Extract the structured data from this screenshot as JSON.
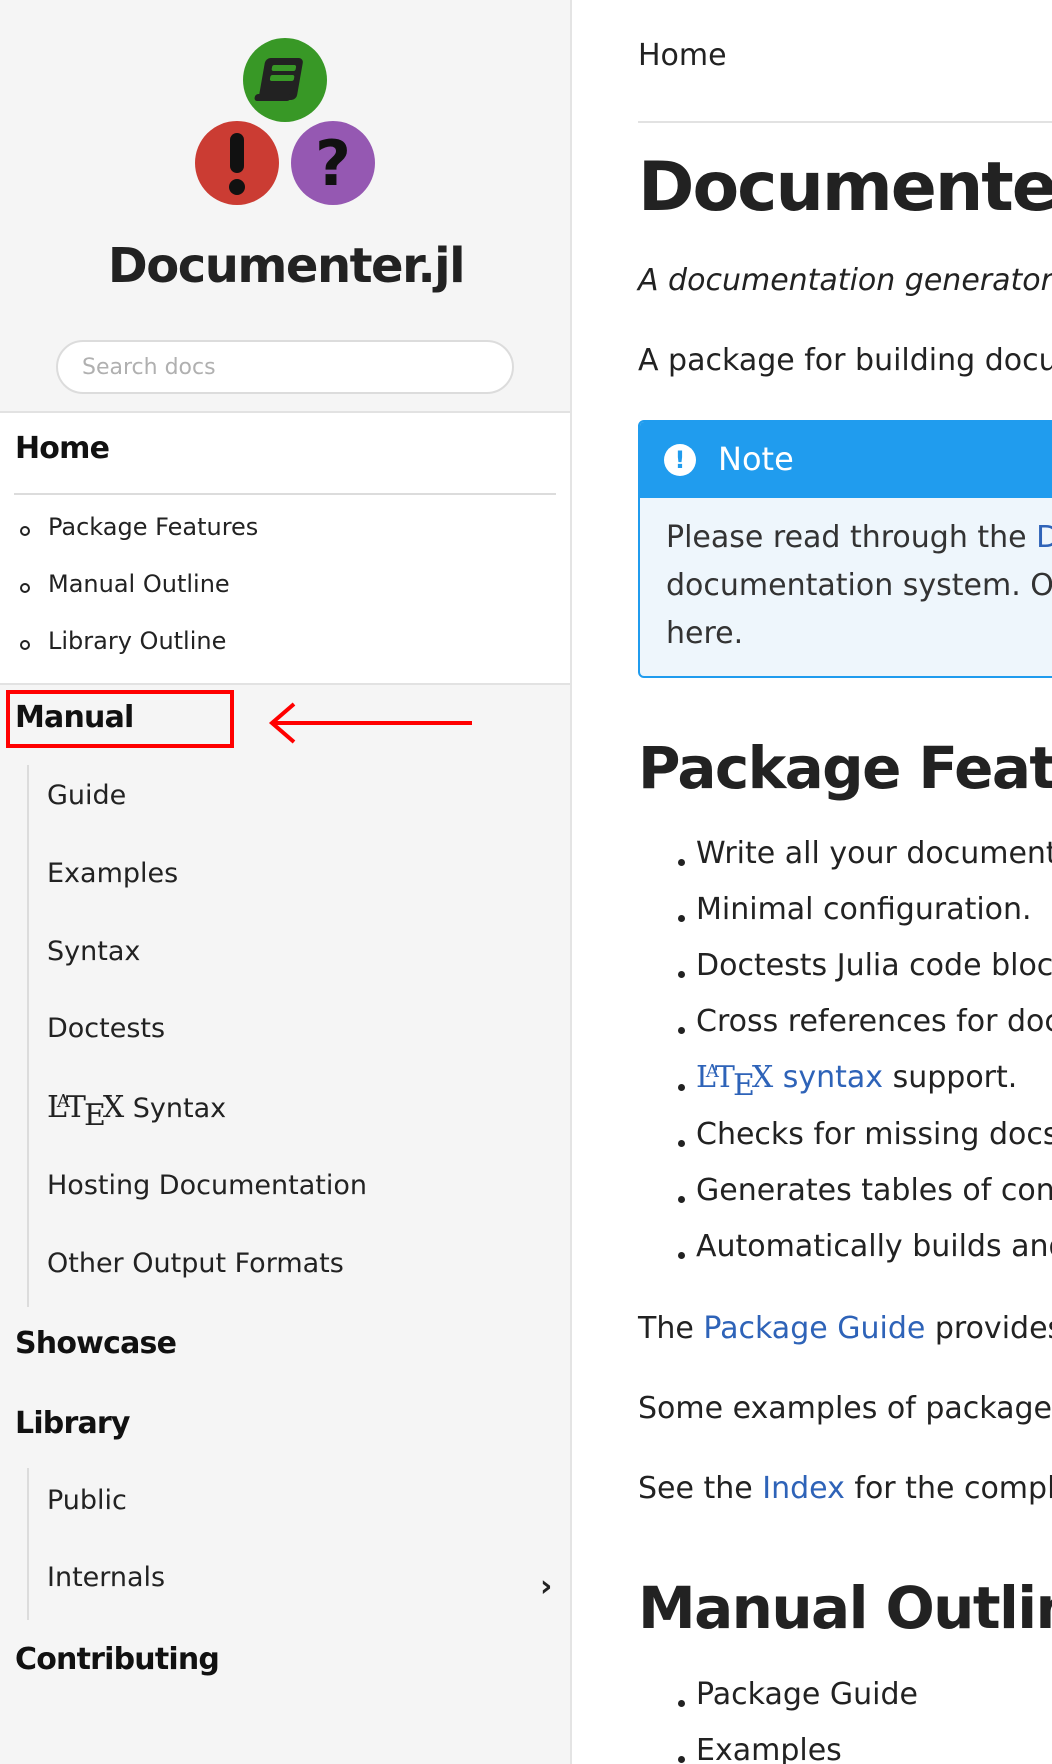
{
  "sidebar": {
    "site_title": "Documenter.jl",
    "search_placeholder": "Search docs",
    "home": {
      "label": "Home",
      "toc": [
        "Package Features",
        "Manual Outline",
        "Library Outline"
      ]
    },
    "manual": {
      "label": "Manual",
      "items": [
        "Guide",
        "Examples",
        "Syntax",
        "Doctests",
        "Syntax",
        "Hosting Documentation",
        "Other Output Formats"
      ],
      "latex_letters": {
        "L": "L",
        "A": "A",
        "T": "T",
        "E": "E",
        "X": "X"
      }
    },
    "showcase": "Showcase",
    "library": {
      "label": "Library",
      "items": [
        "Public",
        "Internals"
      ]
    },
    "contributing": "Contributing",
    "expand_icon": "chevron-right-icon",
    "annotation_color": "#ff0000"
  },
  "main": {
    "breadcrumb": "Home",
    "title": "Documenter.jl",
    "tagline": "A documentation generator for",
    "intro": "A package for building docum",
    "note": {
      "title": "Note",
      "line1_prefix": "Please read through the ",
      "line1_link": "Do",
      "line2": "documentation system. Onc",
      "line3": "here."
    },
    "package_features": {
      "heading": "Package Features",
      "items": [
        "Write all your documenta",
        "Minimal configuration.",
        "Doctests Julia code block",
        "Cross references for docs",
        "LaTeX syntax support.",
        "Checks for missing docstr",
        "Generates tables of conte",
        "Automatically builds and"
      ],
      "latex_item": {
        "link": "syntax",
        "rest": " support."
      }
    },
    "para_guide": {
      "prefix": "The ",
      "link": "Package Guide",
      "suffix": " provides a"
    },
    "para_examples": "Some examples of packages u",
    "para_index": {
      "prefix": "See the ",
      "link": "Index",
      "suffix": " for the complet"
    },
    "manual_outline": {
      "heading": "Manual Outline",
      "items": [
        "Package Guide",
        "Examples"
      ]
    },
    "colors": {
      "link": "#2e63b8",
      "note": "#209cee",
      "note_bg": "#eef6fc"
    }
  }
}
